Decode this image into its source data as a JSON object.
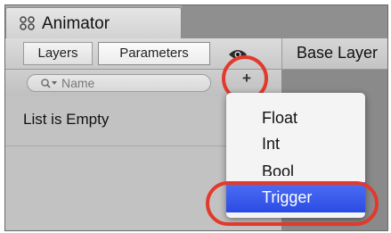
{
  "window": {
    "title": "Animator",
    "icon": "animator-icon"
  },
  "toolbar": {
    "tabs": [
      {
        "label": "Layers",
        "icon": null
      },
      {
        "label": "Parameters",
        "icon": null
      }
    ],
    "visibility_icon": "eye-icon",
    "layer_label": "Base Layer"
  },
  "search": {
    "placeholder": "Name",
    "icon": "search-icon"
  },
  "add_button": {
    "label": "+",
    "icon": "plus-icon"
  },
  "list": {
    "empty_text": "List is Empty"
  },
  "menu": {
    "items": [
      {
        "label": "Float"
      },
      {
        "label": "Int"
      },
      {
        "label": "Bool"
      },
      {
        "label": "Trigger"
      }
    ],
    "highlighted": "Trigger"
  },
  "colors": {
    "annotation_ring": "#e2392c",
    "menu_highlight": "#2a4be4"
  }
}
